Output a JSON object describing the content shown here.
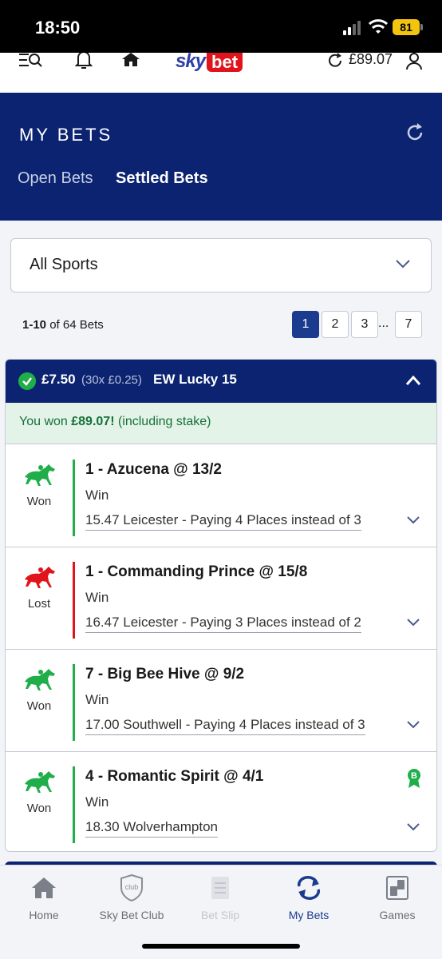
{
  "status_bar": {
    "time": "18:50",
    "battery": "81"
  },
  "top_nav": {
    "logo_sky": "sky",
    "logo_bet": "bet",
    "balance": "£89.07",
    "icons": [
      "search-menu-icon",
      "bell-icon",
      "home-icon",
      "refresh-icon",
      "user-icon"
    ]
  },
  "header": {
    "title": "MY BETS",
    "tabs": [
      {
        "label": "Open Bets",
        "active": false
      },
      {
        "label": "Settled Bets",
        "active": true
      }
    ]
  },
  "filter": {
    "selected": "All Sports"
  },
  "pagination": {
    "range": "1-10",
    "of_text": "of 64 Bets",
    "pages": [
      "1",
      "2",
      "3",
      "7"
    ],
    "current": "1",
    "ellipsis": "..."
  },
  "bet": {
    "stake": "£7.50",
    "lines": "(30x £0.25)",
    "type": "EW Lucky 15",
    "won_prefix": "You won ",
    "won_amount": "£89.07!",
    "won_suffix": " (including stake)",
    "selections": [
      {
        "status": "Won",
        "name": "1 - Azucena @ 13/2",
        "market": "Win",
        "event": "15.47 Leicester - Paying 4 Places instead of 3"
      },
      {
        "status": "Lost",
        "name": "1 - Commanding Prince @ 15/8",
        "market": "Win",
        "event": "16.47 Leicester - Paying 3 Places instead of 2"
      },
      {
        "status": "Won",
        "name": "7 - Big Bee Hive @ 9/2",
        "market": "Win",
        "event": "17.00 Southwell - Paying 4 Places instead of 3"
      },
      {
        "status": "Won",
        "name": "4 - Romantic Spirit @ 4/1",
        "market": "Win",
        "event": "18.30 Wolverhampton",
        "badge": "B"
      }
    ]
  },
  "bottom_nav": {
    "items": [
      {
        "label": "Home",
        "icon": "home-icon"
      },
      {
        "label": "Sky Bet Club",
        "icon": "club-shield-icon",
        "icon_text": "club"
      },
      {
        "label": "Bet Slip",
        "icon": "betslip-icon"
      },
      {
        "label": "My Bets",
        "icon": "my-bets-icon"
      },
      {
        "label": "Games",
        "icon": "games-icon"
      }
    ]
  },
  "colors": {
    "navy": "#0b2370",
    "won_green": "#1fae4a",
    "lost_red": "#e2141b",
    "active_blue": "#1b3b8f"
  }
}
